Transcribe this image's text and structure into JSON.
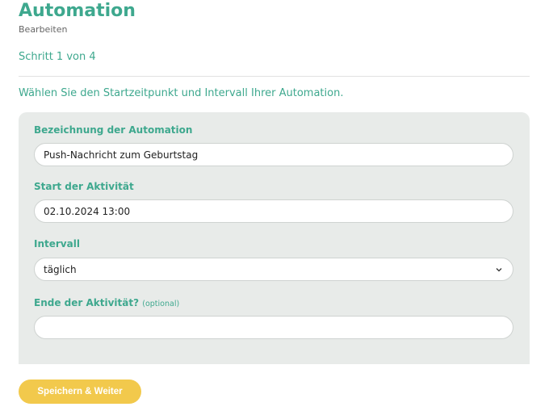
{
  "header": {
    "title": "Automation",
    "subtitle": "Bearbeiten",
    "step": "Schritt 1 von 4"
  },
  "intro": "Wählen Sie den Startzeitpunkt und Intervall Ihrer Automation.",
  "form": {
    "name_label": "Bezeichnung der Automation",
    "name_value": "Push-Nachricht zum Geburtstag",
    "start_label": "Start der Aktivität",
    "start_value": "02.10.2024 13:00",
    "interval_label": "Intervall",
    "interval_value": "täglich",
    "end_label": "Ende der Aktivität?",
    "end_optional": "(optional)",
    "end_value": ""
  },
  "actions": {
    "save_label": "Speichern & Weiter"
  },
  "colors": {
    "accent": "#3ea88e",
    "panel": "#e8ebe9",
    "button": "#f2c94c"
  }
}
